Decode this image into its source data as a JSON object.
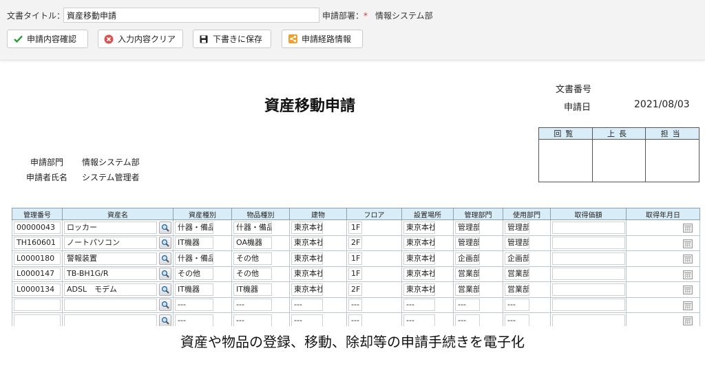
{
  "header": {
    "title_label": "文書タイトル：",
    "title_value": "資産移動申請",
    "dept_label": "申請部署：",
    "dept_required": "*",
    "dept_value": "情報システム部"
  },
  "toolbar": {
    "confirm_label": "申請内容確認",
    "clear_label": "入力内容クリア",
    "save_label": "下書きに保存",
    "route_label": "申請経路情報"
  },
  "document": {
    "title": "資産移動申請",
    "docno_label": "文書番号",
    "date_label": "申請日",
    "date_value": "2021/08/03",
    "approval_headers": [
      "回覧",
      "上長",
      "担当"
    ],
    "dept_label": "申請部門",
    "dept_value": "情報システム部",
    "applicant_label": "申請者氏名",
    "applicant_value": "システム管理者"
  },
  "table": {
    "headers": [
      "管理番号",
      "資産名",
      "資産種別",
      "物品種別",
      "建物",
      "フロア",
      "設置場所",
      "管理部門",
      "使用部門",
      "取得価額",
      "取得年月日"
    ],
    "rows": [
      [
        "00000043",
        "ロッカー",
        "什器・備品",
        "什器・備品",
        "東京本社",
        "1F",
        "東京本社",
        "管理部",
        "管理部",
        "",
        ""
      ],
      [
        "TH160601",
        "ノートパソコン",
        "IT機器",
        "OA機器",
        "東京本社",
        "2F",
        "東京本社",
        "管理部",
        "管理部",
        "",
        ""
      ],
      [
        "L0000180",
        "警報装置",
        "什器・備品",
        "その他",
        "東京本社",
        "1F",
        "東京本社",
        "企画部",
        "企画部",
        "",
        ""
      ],
      [
        "L0000147",
        "TB-BH1G/R",
        "その他",
        "その他",
        "東京本社",
        "1F",
        "東京本社",
        "営業部",
        "営業部",
        "",
        ""
      ],
      [
        "L0000134",
        "ADSL　モデム",
        "IT機器",
        "IT機器",
        "東京本社",
        "2F",
        "東京本社",
        "営業部",
        "営業部",
        "",
        ""
      ],
      [
        "",
        "",
        "---",
        "---",
        "---",
        "---",
        "---",
        "---",
        "---",
        "",
        ""
      ],
      [
        "",
        "",
        "---",
        "---",
        "---",
        "---",
        "---",
        "---",
        "---",
        "",
        ""
      ]
    ]
  },
  "caption": "資産や物品の登録、移動、除却等の申請手続きを電子化",
  "colors": {
    "header_bg": "#d9edf8",
    "check_green": "#2e9b3e",
    "clear_red": "#d9534f",
    "route_orange": "#f0a030"
  },
  "icons": [
    "check-icon",
    "clear-icon",
    "save-icon",
    "route-icon",
    "search-icon",
    "calendar-icon"
  ]
}
